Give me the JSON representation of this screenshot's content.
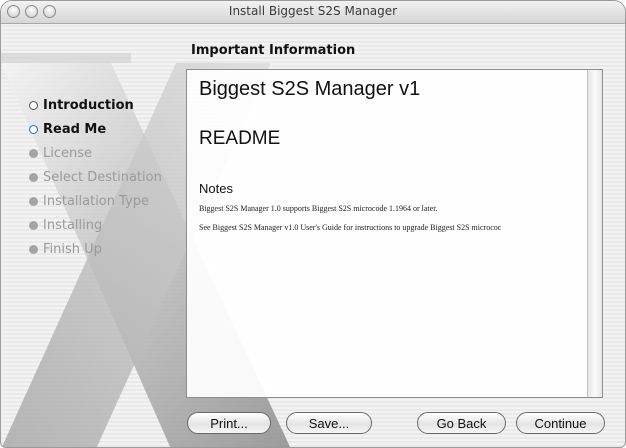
{
  "window": {
    "title": "Install Biggest S2S Manager"
  },
  "section_title": "Important Information",
  "steps": [
    {
      "label": "Introduction",
      "state": "done"
    },
    {
      "label": "Read Me",
      "state": "current"
    },
    {
      "label": "License",
      "state": "pending"
    },
    {
      "label": "Select Destination",
      "state": "pending"
    },
    {
      "label": "Installation Type",
      "state": "pending"
    },
    {
      "label": "Installing",
      "state": "pending"
    },
    {
      "label": "Finish Up",
      "state": "pending"
    }
  ],
  "document": {
    "heading": "Biggest S2S Manager v1",
    "subheading": "README",
    "notes_heading": "Notes",
    "paragraph1": "Biggest S2S Manager 1.0 supports Biggest S2S microcode 1.1964 or later.",
    "paragraph2": "See Biggest S2S Manager v1.0 User's Guide for instructions to upgrade Biggest S2S micrococ"
  },
  "buttons": {
    "print": "Print...",
    "save": "Save...",
    "go_back": "Go Back",
    "continue": "Continue"
  },
  "colors": {
    "step_current_ring": "#2a62c9",
    "step_pending": "#a5a5a5"
  }
}
